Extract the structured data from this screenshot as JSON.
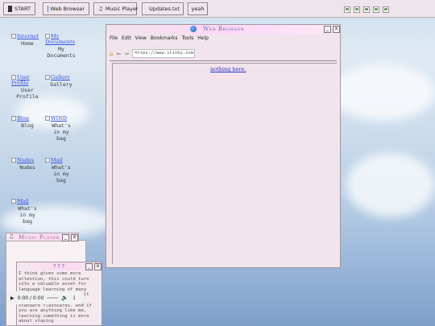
{
  "taskbar": {
    "start_label": "START",
    "buttons": [
      {
        "label": "Web Browser"
      },
      {
        "label": "Music Player"
      },
      {
        "label": "Updates.txt"
      },
      {
        "label": "yeah"
      }
    ],
    "tray_icon_count": 5
  },
  "desktop_icons": [
    {
      "link": "Internet",
      "caption": "Home"
    },
    {
      "link": "My Documents",
      "caption": "My\nDocuments"
    },
    {
      "link": "User Profile",
      "caption": "User\nProfile"
    },
    {
      "link": "Gallery",
      "caption": "Gallery"
    },
    {
      "link": "Blog",
      "caption": "Blog"
    },
    {
      "link": "WIND",
      "caption": "What's\nin my\nbag"
    },
    {
      "link": "Nudes",
      "caption": "Nudes"
    },
    {
      "link": "Mail",
      "caption": "What's\nin my\nbag"
    },
    {
      "link": "Mail",
      "caption": "What's\nin my\nbag"
    }
  ],
  "browser": {
    "title": "Web Browser",
    "menu": [
      "File",
      "Edit",
      "View",
      "Bookmarks",
      "Tools",
      "Help"
    ],
    "url": "https://www.stinky.com",
    "back": "⇐",
    "forward": "⇒",
    "content_link": "nothing here."
  },
  "music_player": {
    "title": "Music Player",
    "time": "0:00 / 0:00"
  },
  "note": {
    "title": "???",
    "text": "I think given some more attention, this could turn into a valuable asset for language learning of many different types. I find it more entertaining than standard flashcards. And if you are anything like me, learning something is more about staying"
  }
}
